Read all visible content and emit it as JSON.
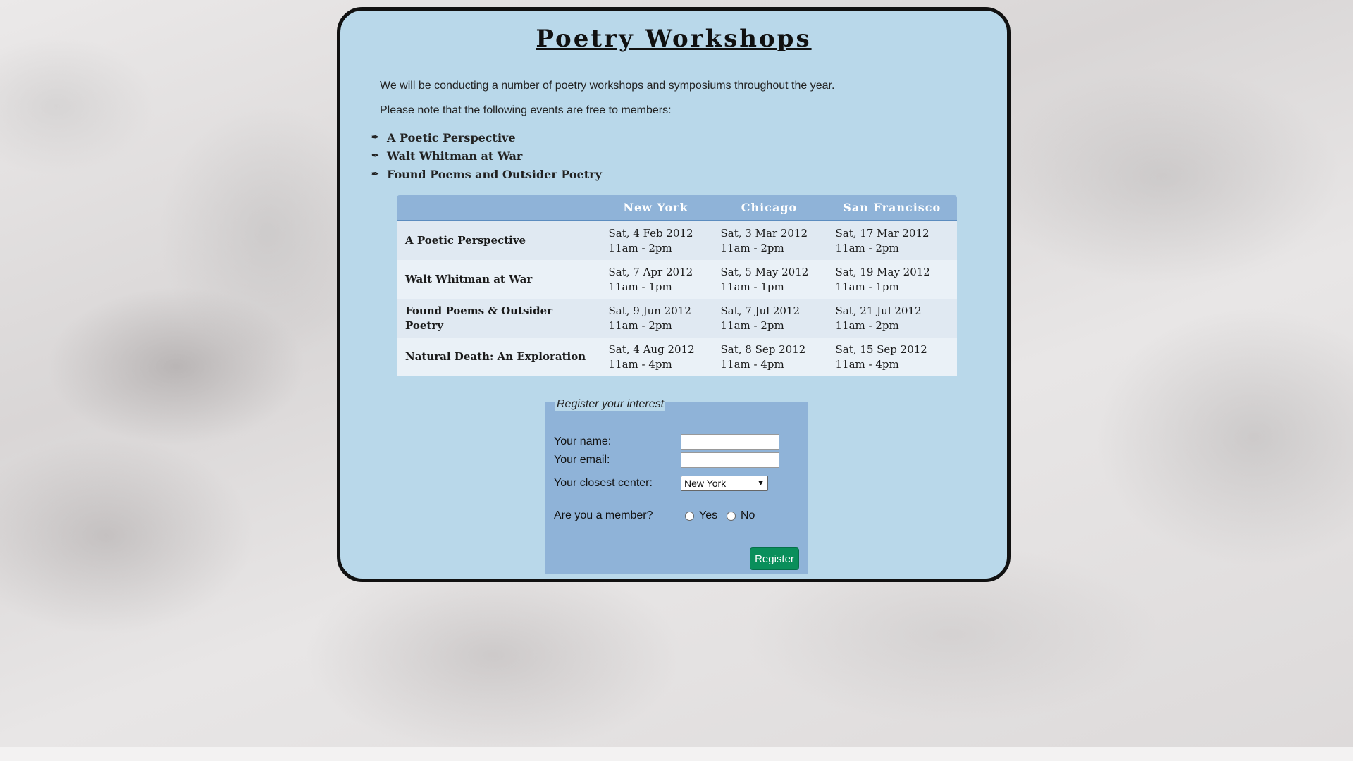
{
  "page": {
    "title": "Poetry Workshops",
    "intro_line1": "We will be conducting a number of poetry workshops and symposiums throughout the year.",
    "intro_line2": "Please note that the following events are free to members:"
  },
  "free_events": [
    "A Poetic Perspective",
    "Walt Whitman at War",
    "Found Poems and Outsider Poetry"
  ],
  "schedule": {
    "headers": [
      "",
      "New York",
      "Chicago",
      "San Francisco"
    ],
    "rows": [
      {
        "event": "A Poetic Perspective",
        "cells": [
          {
            "date": "Sat, 4 Feb 2012",
            "time": "11am - 2pm"
          },
          {
            "date": "Sat, 3 Mar 2012",
            "time": "11am - 2pm"
          },
          {
            "date": "Sat, 17 Mar 2012",
            "time": "11am - 2pm"
          }
        ]
      },
      {
        "event": "Walt Whitman at War",
        "cells": [
          {
            "date": "Sat, 7 Apr 2012",
            "time": "11am - 1pm"
          },
          {
            "date": "Sat, 5 May 2012",
            "time": "11am - 1pm"
          },
          {
            "date": "Sat, 19 May 2012",
            "time": "11am - 1pm"
          }
        ]
      },
      {
        "event": "Found Poems & Outsider Poetry",
        "cells": [
          {
            "date": "Sat, 9 Jun 2012",
            "time": "11am - 2pm"
          },
          {
            "date": "Sat, 7 Jul 2012",
            "time": "11am - 2pm"
          },
          {
            "date": "Sat, 21 Jul 2012",
            "time": "11am - 2pm"
          }
        ]
      },
      {
        "event": "Natural Death: An Exploration",
        "cells": [
          {
            "date": "Sat, 4 Aug 2012",
            "time": "11am - 4pm"
          },
          {
            "date": "Sat, 8 Sep 2012",
            "time": "11am - 4pm"
          },
          {
            "date": "Sat, 15 Sep 2012",
            "time": "11am - 4pm"
          }
        ]
      }
    ]
  },
  "form": {
    "legend": "Register your interest",
    "name_label": "Your name:",
    "name_value": "",
    "email_label": "Your email:",
    "email_value": "",
    "center_label": "Your closest center:",
    "center_selected": "New York",
    "member_label": "Are you a member?",
    "member_yes": "Yes",
    "member_no": "No",
    "register_label": "Register"
  },
  "icons": {
    "bullet": "quill-pen-icon",
    "select_arrow": "chevron-down-icon"
  },
  "colors": {
    "panel_bg": "#b9d8ea",
    "table_header_bg": "#8fb3d8",
    "form_bg": "#8fb3d8",
    "button_bg": "#0a8f5b"
  }
}
